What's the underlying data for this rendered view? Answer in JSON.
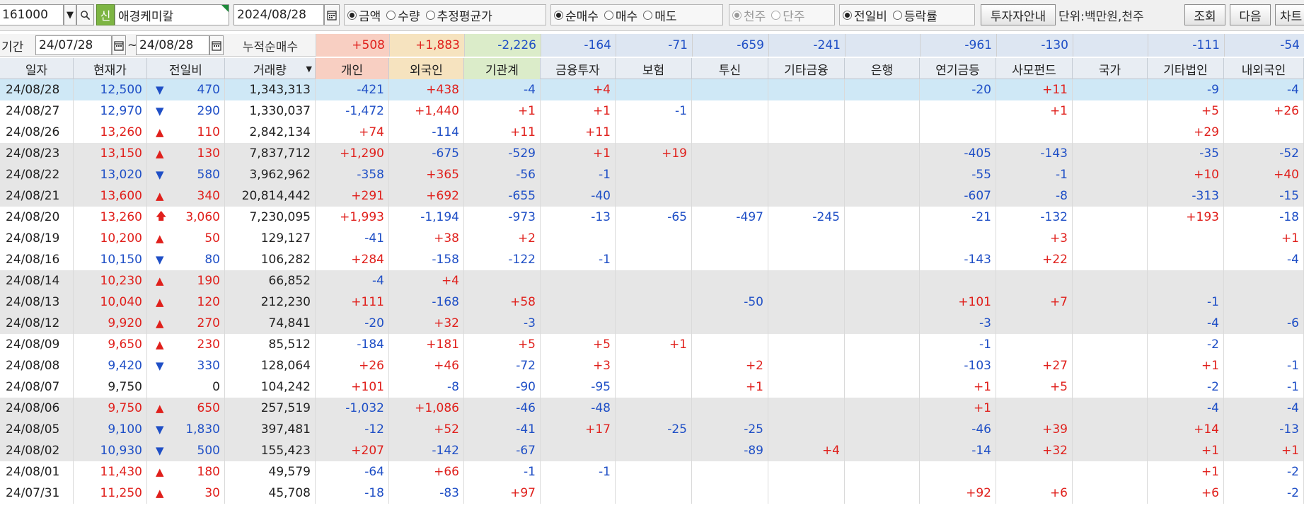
{
  "toolbar": {
    "code": "161000",
    "badge": "신",
    "name": "애경케미칼",
    "date": "2024/08/28",
    "value_group": [
      {
        "label": "금액",
        "selected": true
      },
      {
        "label": "수량",
        "selected": false
      },
      {
        "label": "추정평균가",
        "selected": false
      }
    ],
    "trade_group": [
      {
        "label": "순매수",
        "selected": true
      },
      {
        "label": "매수",
        "selected": false
      },
      {
        "label": "매도",
        "selected": false
      }
    ],
    "unit_group": [
      {
        "label": "천주",
        "selected": true
      },
      {
        "label": "단주",
        "selected": false
      }
    ],
    "compare_group": [
      {
        "label": "전일비",
        "selected": true
      },
      {
        "label": "등락률",
        "selected": false
      }
    ],
    "investor_button": "투자자안내",
    "unit_label": "단위:백만원,천주",
    "query_button": "조회",
    "next_button": "다음",
    "chart_button": "차트"
  },
  "period": {
    "label": "기간",
    "from": "24/07/28",
    "sep": "~",
    "to": "24/08/28",
    "cumulative_label": "누적순매수",
    "cumulative": [
      "+508",
      "+1,883",
      "-2,226",
      "-164",
      "-71",
      "-659",
      "-241",
      "",
      "-961",
      "-130",
      "",
      "-111",
      "-54"
    ]
  },
  "colors": {
    "individual_bg": "#f8cfc2",
    "foreign_bg": "#f6e3bf",
    "institution_bg": "#dbecc9",
    "others_bg": "#dde6f2",
    "up": "#e0201c",
    "down": "#1f4fc6"
  },
  "columns": [
    "일자",
    "현재가",
    "전일비",
    "거래량",
    "개인",
    "외국인",
    "기관계",
    "금융투자",
    "보험",
    "투신",
    "기타금융",
    "은행",
    "연기금등",
    "사모펀드",
    "국가",
    "기타법인",
    "내외국인"
  ],
  "rows": [
    {
      "date": "24/08/28",
      "price": "12,500",
      "dir": "down",
      "arrow": "▼",
      "chg": "470",
      "vol": "1,343,313",
      "v": [
        "-421",
        "+438",
        "-4",
        "+4",
        "",
        "",
        "",
        "",
        "-20",
        "+11",
        "",
        "-9",
        "-4"
      ]
    },
    {
      "date": "24/08/27",
      "price": "12,970",
      "dir": "down",
      "arrow": "▼",
      "chg": "290",
      "vol": "1,330,037",
      "v": [
        "-1,472",
        "+1,440",
        "+1",
        "+1",
        "-1",
        "",
        "",
        "",
        "",
        "+1",
        "",
        "+5",
        "+26"
      ]
    },
    {
      "date": "24/08/26",
      "price": "13,260",
      "dir": "up",
      "arrow": "▲",
      "chg": "110",
      "vol": "2,842,134",
      "v": [
        "+74",
        "-114",
        "+11",
        "+11",
        "",
        "",
        "",
        "",
        "",
        "",
        "",
        "+29",
        ""
      ]
    },
    {
      "date": "24/08/23",
      "price": "13,150",
      "dir": "up",
      "arrow": "▲",
      "chg": "130",
      "vol": "7,837,712",
      "v": [
        "+1,290",
        "-675",
        "-529",
        "+1",
        "+19",
        "",
        "",
        "",
        "-405",
        "-143",
        "",
        "-35",
        "-52"
      ]
    },
    {
      "date": "24/08/22",
      "price": "13,020",
      "dir": "down",
      "arrow": "▼",
      "chg": "580",
      "vol": "3,962,962",
      "v": [
        "-358",
        "+365",
        "-56",
        "-1",
        "",
        "",
        "",
        "",
        "-55",
        "-1",
        "",
        "+10",
        "+40"
      ]
    },
    {
      "date": "24/08/21",
      "price": "13,600",
      "dir": "up",
      "arrow": "▲",
      "chg": "340",
      "vol": "20,814,442",
      "v": [
        "+291",
        "+692",
        "-655",
        "-40",
        "",
        "",
        "",
        "",
        "-607",
        "-8",
        "",
        "-313",
        "-15"
      ]
    },
    {
      "date": "24/08/20",
      "price": "13,260",
      "dir": "up",
      "arrow": "🡅",
      "chg": "3,060",
      "vol": "7,230,095",
      "v": [
        "+1,993",
        "-1,194",
        "-973",
        "-13",
        "-65",
        "-497",
        "-245",
        "",
        "-21",
        "-132",
        "",
        "+193",
        "-18"
      ]
    },
    {
      "date": "24/08/19",
      "price": "10,200",
      "dir": "up",
      "arrow": "▲",
      "chg": "50",
      "vol": "129,127",
      "v": [
        "-41",
        "+38",
        "+2",
        "",
        "",
        "",
        "",
        "",
        "",
        "+3",
        "",
        "",
        "+1"
      ]
    },
    {
      "date": "24/08/16",
      "price": "10,150",
      "dir": "down",
      "arrow": "▼",
      "chg": "80",
      "vol": "106,282",
      "v": [
        "+284",
        "-158",
        "-122",
        "-1",
        "",
        "",
        "",
        "",
        "-143",
        "+22",
        "",
        "",
        "-4"
      ]
    },
    {
      "date": "24/08/14",
      "price": "10,230",
      "dir": "up",
      "arrow": "▲",
      "chg": "190",
      "vol": "66,852",
      "v": [
        "-4",
        "+4",
        "",
        "",
        "",
        "",
        "",
        "",
        "",
        "",
        "",
        "",
        ""
      ]
    },
    {
      "date": "24/08/13",
      "price": "10,040",
      "dir": "up",
      "arrow": "▲",
      "chg": "120",
      "vol": "212,230",
      "v": [
        "+111",
        "-168",
        "+58",
        "",
        "",
        "-50",
        "",
        "",
        "+101",
        "+7",
        "",
        "-1",
        ""
      ]
    },
    {
      "date": "24/08/12",
      "price": "9,920",
      "dir": "up",
      "arrow": "▲",
      "chg": "270",
      "vol": "74,841",
      "v": [
        "-20",
        "+32",
        "-3",
        "",
        "",
        "",
        "",
        "",
        "-3",
        "",
        "",
        "-4",
        "-6"
      ]
    },
    {
      "date": "24/08/09",
      "price": "9,650",
      "dir": "up",
      "arrow": "▲",
      "chg": "230",
      "vol": "85,512",
      "v": [
        "-184",
        "+181",
        "+5",
        "+5",
        "+1",
        "",
        "",
        "",
        "-1",
        "",
        "",
        "-2",
        ""
      ]
    },
    {
      "date": "24/08/08",
      "price": "9,420",
      "dir": "down",
      "arrow": "▼",
      "chg": "330",
      "vol": "128,064",
      "v": [
        "+26",
        "+46",
        "-72",
        "+3",
        "",
        "+2",
        "",
        "",
        "-103",
        "+27",
        "",
        "+1",
        "-1"
      ]
    },
    {
      "date": "24/08/07",
      "price": "9,750",
      "dir": "flat",
      "arrow": "",
      "chg": "0",
      "vol": "104,242",
      "v": [
        "+101",
        "-8",
        "-90",
        "-95",
        "",
        "+1",
        "",
        "",
        "+1",
        "+5",
        "",
        "-2",
        "-1"
      ]
    },
    {
      "date": "24/08/06",
      "price": "9,750",
      "dir": "up",
      "arrow": "▲",
      "chg": "650",
      "vol": "257,519",
      "v": [
        "-1,032",
        "+1,086",
        "-46",
        "-48",
        "",
        "",
        "",
        "",
        "+1",
        "",
        "",
        "-4",
        "-4"
      ]
    },
    {
      "date": "24/08/05",
      "price": "9,100",
      "dir": "down",
      "arrow": "▼",
      "chg": "1,830",
      "vol": "397,481",
      "v": [
        "-12",
        "+52",
        "-41",
        "+17",
        "-25",
        "-25",
        "",
        "",
        "-46",
        "+39",
        "",
        "+14",
        "-13"
      ]
    },
    {
      "date": "24/08/02",
      "price": "10,930",
      "dir": "down",
      "arrow": "▼",
      "chg": "500",
      "vol": "155,423",
      "v": [
        "+207",
        "-142",
        "-67",
        "",
        "",
        "-89",
        "+4",
        "",
        "-14",
        "+32",
        "",
        "+1",
        "+1"
      ]
    },
    {
      "date": "24/08/01",
      "price": "11,430",
      "dir": "up",
      "arrow": "▲",
      "chg": "180",
      "vol": "49,579",
      "v": [
        "-64",
        "+66",
        "-1",
        "-1",
        "",
        "",
        "",
        "",
        "",
        "",
        "",
        "+1",
        "-2"
      ]
    },
    {
      "date": "24/07/31",
      "price": "11,250",
      "dir": "up",
      "arrow": "▲",
      "chg": "30",
      "vol": "45,708",
      "v": [
        "-18",
        "-83",
        "+97",
        "",
        "",
        "",
        "",
        "",
        "+92",
        "+6",
        "",
        "+6",
        "-2"
      ]
    }
  ]
}
